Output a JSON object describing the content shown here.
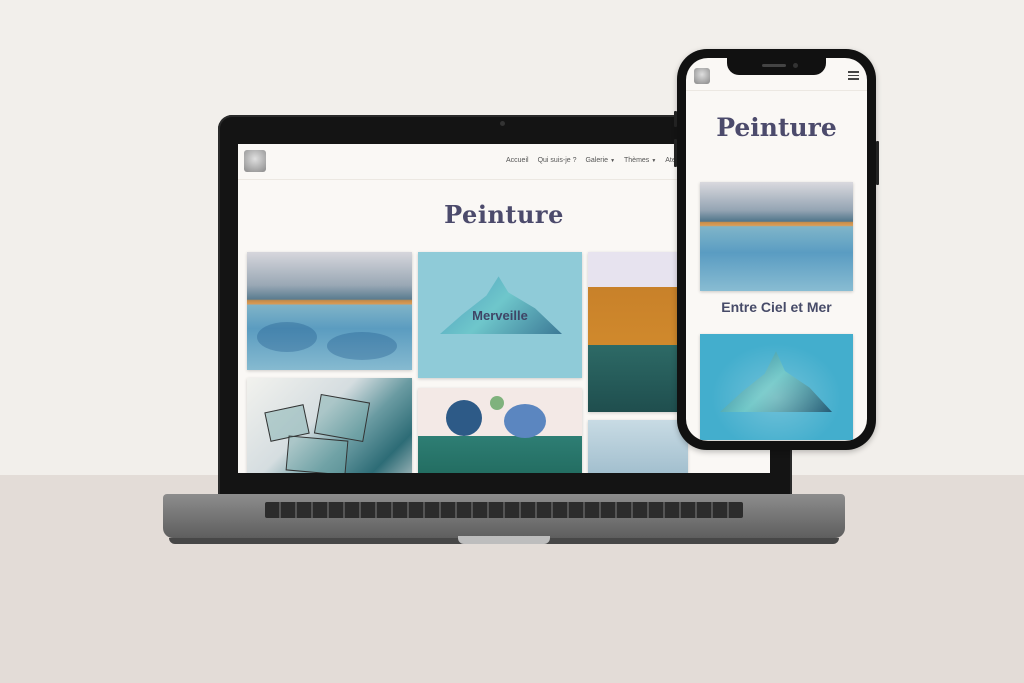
{
  "site": {
    "nav": [
      "Accueil",
      "Qui suis-je ?",
      "Galerie",
      "Thèmes",
      "Ate"
    ],
    "page_title": "Peinture",
    "gallery": {
      "overlay_label": "Merveille"
    }
  },
  "phone": {
    "page_title": "Peinture",
    "first_caption": "Entre Ciel et Mer"
  },
  "icons": {
    "logo": "artist-logo-icon",
    "menu": "hamburger-menu-icon",
    "dropdown": "chevron-down-icon"
  }
}
